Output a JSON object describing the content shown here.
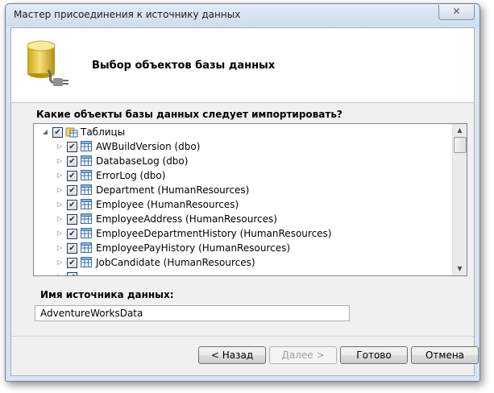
{
  "window": {
    "title": "Мастер присоединения к источнику данных",
    "close_glyph": "✕"
  },
  "header": {
    "title": "Выбор объектов базы данных",
    "icon": "database-plug-icon"
  },
  "objects": {
    "question": "Какие объекты базы данных следует импортировать?",
    "root": {
      "label": "Таблицы",
      "checked": true,
      "expanded": true
    },
    "items": [
      {
        "label": "AWBuildVersion (dbo)",
        "checked": true
      },
      {
        "label": "DatabaseLog (dbo)",
        "checked": true
      },
      {
        "label": "ErrorLog (dbo)",
        "checked": true
      },
      {
        "label": "Department (HumanResources)",
        "checked": true
      },
      {
        "label": "Employee (HumanResources)",
        "checked": true
      },
      {
        "label": "EmployeeAddress (HumanResources)",
        "checked": true
      },
      {
        "label": "EmployeeDepartmentHistory (HumanResources)",
        "checked": true
      },
      {
        "label": "EmployeePayHistory (HumanResources)",
        "checked": true
      },
      {
        "label": "JobCandidate (HumanResources)",
        "checked": true
      }
    ]
  },
  "datasource": {
    "label": "Имя источника данных:",
    "value": "AdventureWorksData"
  },
  "buttons": {
    "back": "< Назад",
    "next": "Далее >",
    "finish": "Готово",
    "cancel": "Отмена"
  },
  "colors": {
    "window_frame": "#d9e4f1",
    "content_bg": "#f0f0f0",
    "checkbox_border": "#1e395b"
  }
}
